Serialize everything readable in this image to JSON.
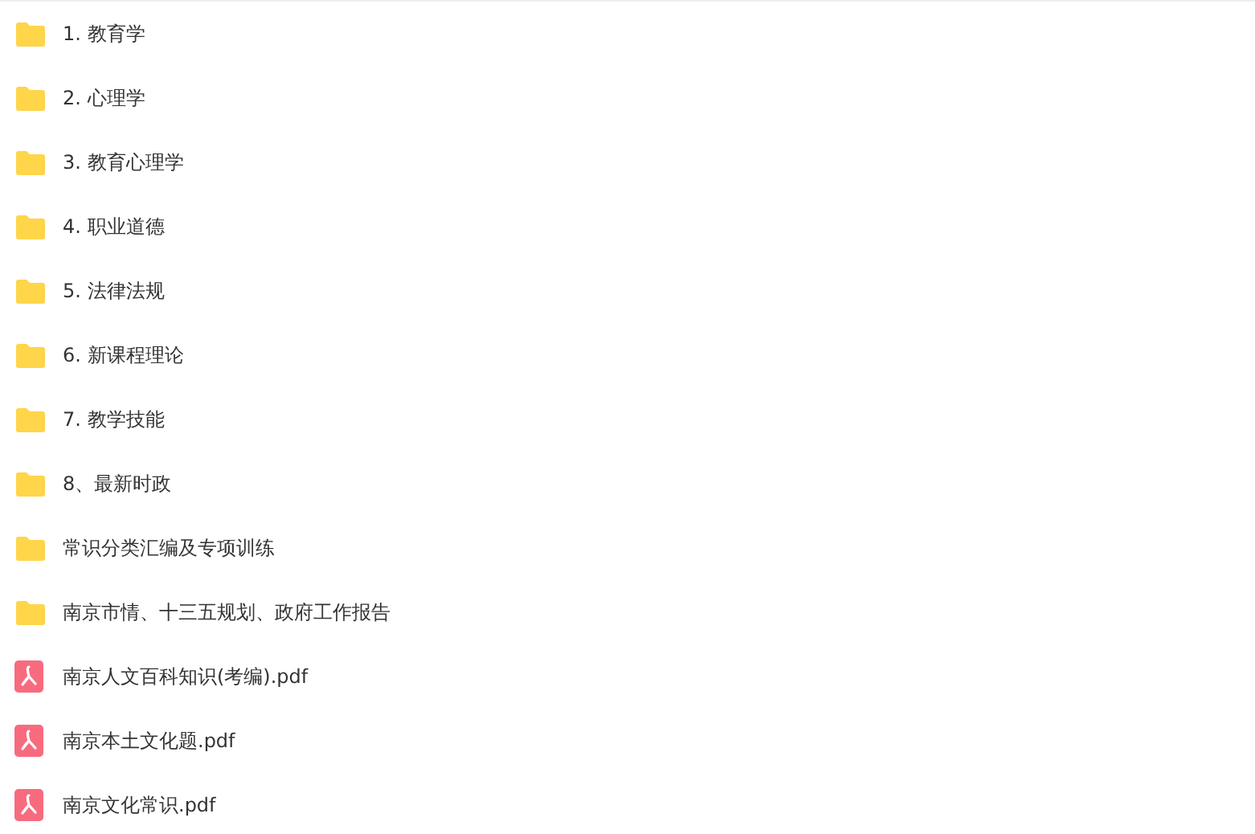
{
  "files": [
    {
      "kind": "folder",
      "name": "1. 教育学"
    },
    {
      "kind": "folder",
      "name": "2. 心理学"
    },
    {
      "kind": "folder",
      "name": "3. 教育心理学"
    },
    {
      "kind": "folder",
      "name": "4. 职业道德"
    },
    {
      "kind": "folder",
      "name": "5. 法律法规"
    },
    {
      "kind": "folder",
      "name": "6. 新课程理论"
    },
    {
      "kind": "folder",
      "name": "7. 教学技能"
    },
    {
      "kind": "folder",
      "name": "8、最新时政"
    },
    {
      "kind": "folder",
      "name": "常识分类汇编及专项训练"
    },
    {
      "kind": "folder",
      "name": "南京市情、十三五规划、政府工作报告"
    },
    {
      "kind": "pdf",
      "name": "南京人文百科知识(考编).pdf"
    },
    {
      "kind": "pdf",
      "name": "南京本土文化题.pdf"
    },
    {
      "kind": "pdf",
      "name": "南京文化常识.pdf"
    }
  ]
}
